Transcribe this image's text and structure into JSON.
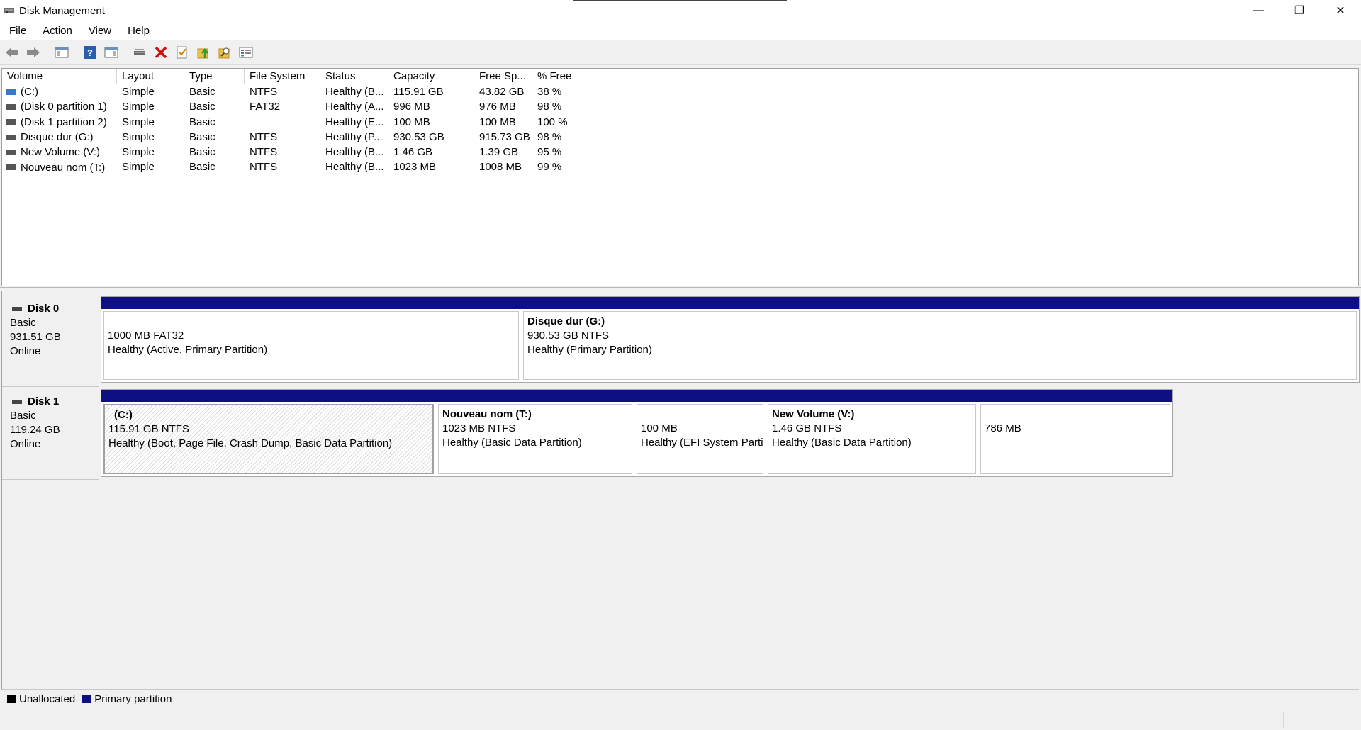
{
  "window": {
    "title": "Disk Management",
    "minimize_glyph": "—",
    "maximize_glyph": "❐",
    "close_glyph": "✕"
  },
  "menu": [
    "File",
    "Action",
    "View",
    "Help"
  ],
  "toolbar": {
    "icons": [
      "back-arrow-icon",
      "forward-arrow-icon",
      "console-tree-icon",
      "help-icon",
      "properties-pane-icon",
      "connect-drive-icon",
      "delete-icon",
      "check-icon",
      "up-folder-icon",
      "search-folder-icon",
      "list-view-icon"
    ],
    "colors": {
      "delete": "#cc1111",
      "help": "#2a5db0",
      "folder": "#e8c04a"
    }
  },
  "volume_list": {
    "columns": [
      "Volume",
      "Layout",
      "Type",
      "File System",
      "Status",
      "Capacity",
      "Free Sp...",
      "% Free"
    ],
    "rows": [
      {
        "volume": "(C:)",
        "layout": "Simple",
        "type": "Basic",
        "fs": "NTFS",
        "status": "Healthy (B...",
        "capacity": "115.91 GB",
        "free": "43.82 GB",
        "pct": "38 %",
        "icon_color": "#3a78c8"
      },
      {
        "volume": "(Disk 0 partition 1)",
        "layout": "Simple",
        "type": "Basic",
        "fs": "FAT32",
        "status": "Healthy (A...",
        "capacity": "996 MB",
        "free": "976 MB",
        "pct": "98 %",
        "icon_color": "#555555"
      },
      {
        "volume": "(Disk 1 partition 2)",
        "layout": "Simple",
        "type": "Basic",
        "fs": "",
        "status": "Healthy (E...",
        "capacity": "100 MB",
        "free": "100 MB",
        "pct": "100 %",
        "icon_color": "#555555"
      },
      {
        "volume": "Disque dur (G:)",
        "layout": "Simple",
        "type": "Basic",
        "fs": "NTFS",
        "status": "Healthy (P...",
        "capacity": "930.53 GB",
        "free": "915.73 GB",
        "pct": "98 %",
        "icon_color": "#555555"
      },
      {
        "volume": "New Volume (V:)",
        "layout": "Simple",
        "type": "Basic",
        "fs": "NTFS",
        "status": "Healthy (B...",
        "capacity": "1.46 GB",
        "free": "1.39 GB",
        "pct": "95 %",
        "icon_color": "#555555"
      },
      {
        "volume": "Nouveau nom (T:)",
        "layout": "Simple",
        "type": "Basic",
        "fs": "NTFS",
        "status": "Healthy (B...",
        "capacity": "1023 MB",
        "free": "1008 MB",
        "pct": "99 %",
        "icon_color": "#555555"
      }
    ]
  },
  "disks": [
    {
      "name": "Disk 0",
      "type": "Basic",
      "size": "931.51 GB",
      "state": "Online",
      "partitions": [
        {
          "title": "",
          "line1": "1000 MB FAT32",
          "line2": "Healthy (Active, Primary Partition)"
        },
        {
          "title": "Disque dur  (G:)",
          "line1": "930.53 GB NTFS",
          "line2": "Healthy (Primary Partition)"
        }
      ]
    },
    {
      "name": "Disk 1",
      "type": "Basic",
      "size": "119.24 GB",
      "state": "Online",
      "partitions": [
        {
          "title": "(C:)",
          "line1": "115.91 GB NTFS",
          "line2": "Healthy (Boot, Page File, Crash Dump, Basic Data Partition)",
          "selected": true
        },
        {
          "title": "Nouveau nom  (T:)",
          "line1": "1023 MB NTFS",
          "line2": "Healthy (Basic Data Partition)"
        },
        {
          "title": "",
          "line1": "100 MB",
          "line2": "Healthy (EFI System Parti"
        },
        {
          "title": "New Volume  (V:)",
          "line1": "1.46 GB NTFS",
          "line2": "Healthy (Basic Data Partition)"
        },
        {
          "title": "",
          "line1": "786 MB",
          "line2": ""
        }
      ]
    }
  ],
  "legend": [
    {
      "label": "Unallocated",
      "color": "#000000"
    },
    {
      "label": "Primary partition",
      "color": "#0f0f84"
    }
  ]
}
